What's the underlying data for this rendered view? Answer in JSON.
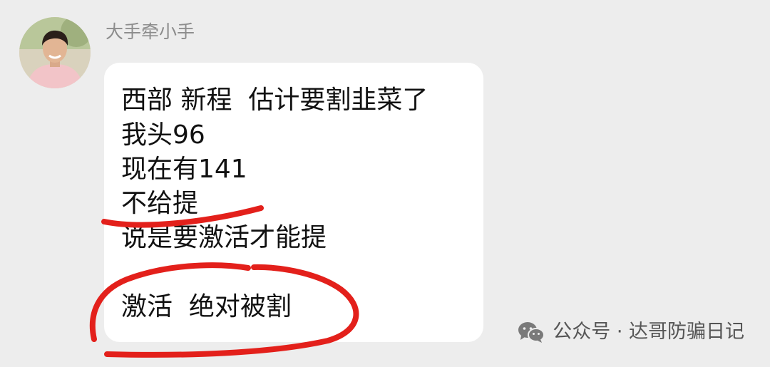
{
  "chat": {
    "sender_name": "大手牵小手",
    "avatar_icon": "person-avatar",
    "message_lines": [
      "西部 新程  估计要割韭菜了",
      "我头96",
      "现在有141",
      "不给提",
      "说是要激活才能提",
      "激活  绝对被割"
    ]
  },
  "watermark": {
    "icon": "wechat-icon",
    "text": "公众号 · 达哥防骗日记"
  },
  "colors": {
    "background": "#ededed",
    "bubble": "#ffffff",
    "annotation_red": "#e3201b",
    "name_gray": "#8c8c8c"
  }
}
